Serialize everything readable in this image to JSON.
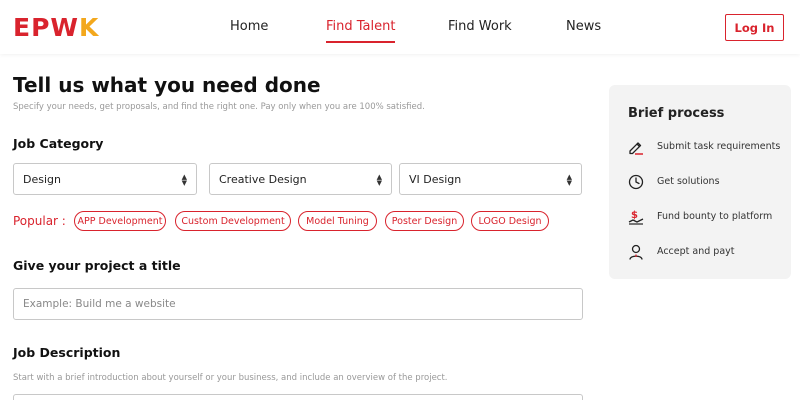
{
  "header": {
    "logo": {
      "part1": "EPW",
      "part2": "K"
    },
    "nav": [
      {
        "label": "Home"
      },
      {
        "label": "Find Talent"
      },
      {
        "label": "Find Work"
      },
      {
        "label": "News"
      }
    ],
    "active_nav": "Find Talent",
    "login_label": "Log In"
  },
  "main": {
    "title": "Tell us what you need done",
    "subtitle": "Specify your needs, get proposals, and find the right one. Pay only when you are 100% satisfied.",
    "job_category": {
      "label": "Job Category",
      "selects": [
        {
          "value": "Design"
        },
        {
          "value": "Creative Design"
        },
        {
          "value": "VI Design"
        }
      ]
    },
    "popular": {
      "label": "Popular :",
      "tags": [
        "APP Development",
        "Custom Development",
        "Model Tuning",
        "Poster Design",
        "LOGO Design"
      ]
    },
    "project_title": {
      "label": "Give your project a title",
      "placeholder": "Example: Build me a website",
      "value": ""
    },
    "job_description": {
      "label": "Job Description",
      "hint": "Start with a brief introduction about yourself or your business, and include an overview of the project."
    }
  },
  "side_panel": {
    "title": "Brief process",
    "steps": [
      {
        "label": "Submit task requirements",
        "icon": "pencil-icon"
      },
      {
        "label": "Get solutions",
        "icon": "clock-icon"
      },
      {
        "label": "Fund bounty to platform",
        "icon": "money-icon"
      },
      {
        "label": "Accept and payt",
        "icon": "user-icon"
      }
    ]
  },
  "colors": {
    "brand_red": "#d9232d",
    "brand_orange": "#f3a81d",
    "panel_bg": "#f3f3f3"
  }
}
